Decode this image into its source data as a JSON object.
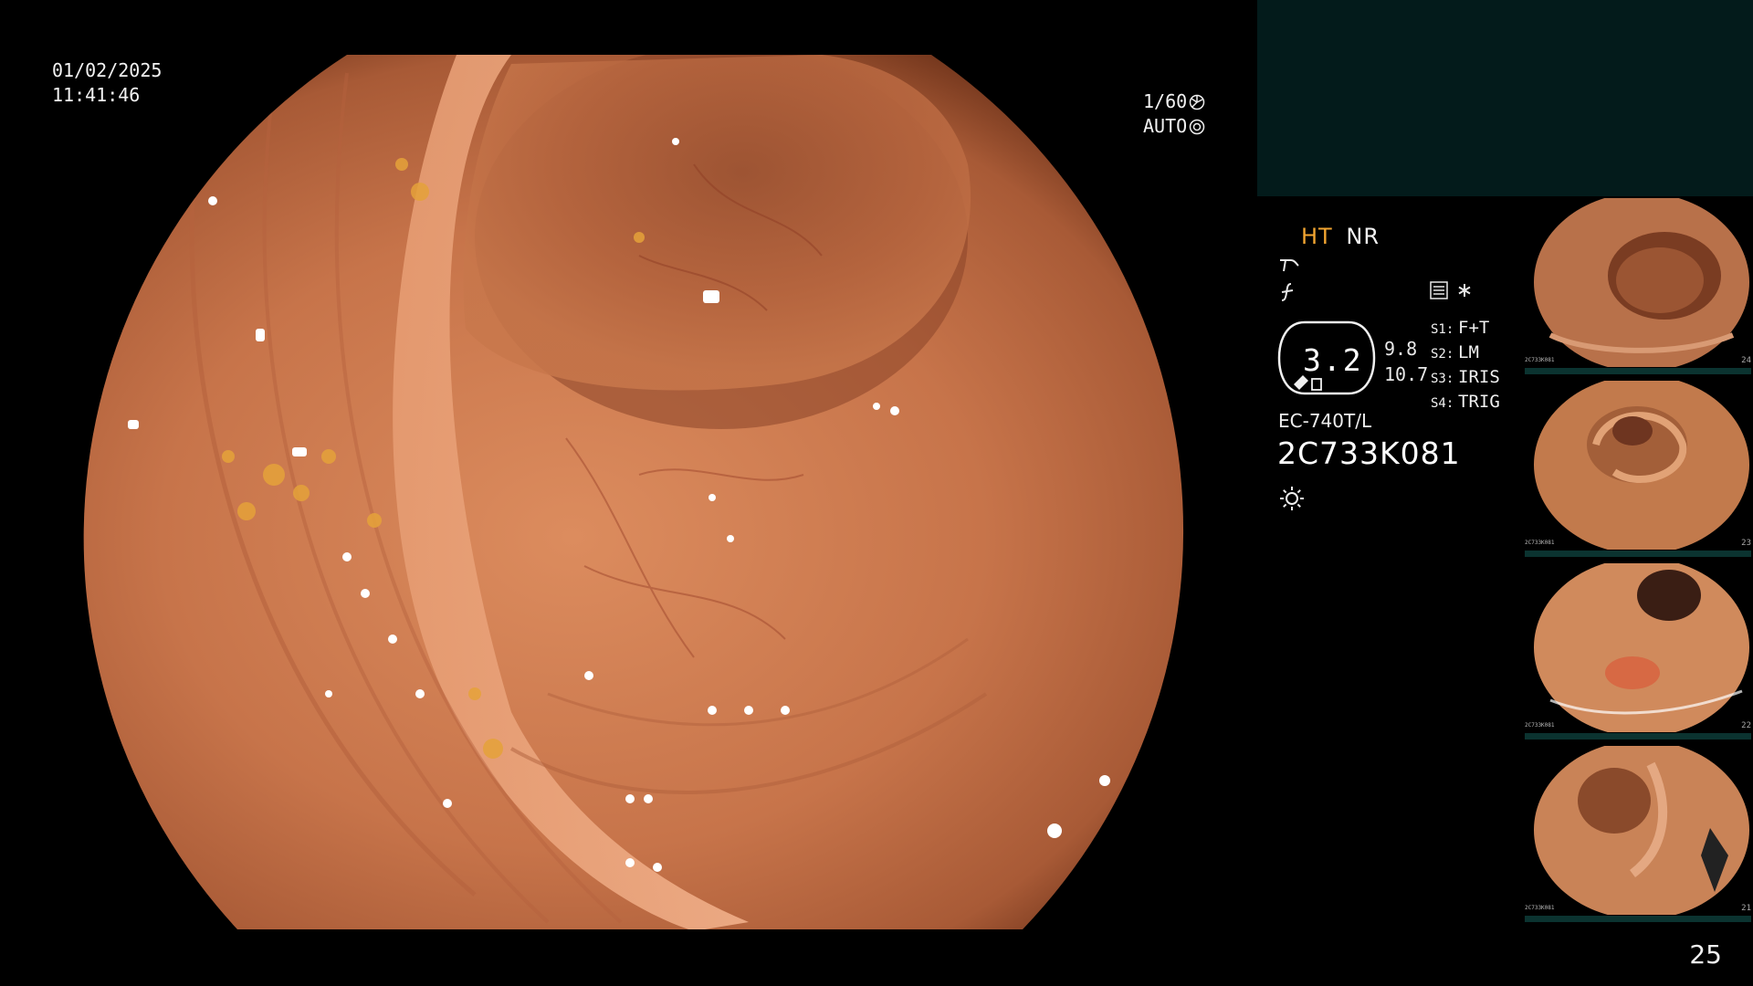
{
  "overlay": {
    "date": "01/02/2025",
    "time": "11:41:46",
    "shutter_speed": "1/60",
    "iris_mode": "AUTO"
  },
  "status": {
    "mode_ht": "HT",
    "mode_nr": "NR",
    "zoom": "3.2",
    "value_a": "9.8",
    "value_b": "10.7",
    "switches": [
      {
        "key": "S1:",
        "value": "F+T"
      },
      {
        "key": "S2:",
        "value": "LM"
      },
      {
        "key": "S3:",
        "value": "IRIS"
      },
      {
        "key": "S4:",
        "value": "TRIG"
      }
    ],
    "scope_model": "EC-740T/L",
    "scope_serial": "2C733K081",
    "icons": [
      "enhancement-icon",
      "structure-icon",
      "settings-icon",
      "asterisk-icon",
      "light-icon"
    ]
  },
  "thumbnails": [
    {
      "label": "Thumbnail 1",
      "index_text": "24",
      "meta": "2C733K081"
    },
    {
      "label": "Thumbnail 2",
      "index_text": "23",
      "meta": "2C733K081"
    },
    {
      "label": "Thumbnail 3",
      "index_text": "22",
      "meta": "2C733K081"
    },
    {
      "label": "Thumbnail 4",
      "index_text": "21",
      "meta": "2C733K081"
    }
  ],
  "page_number": "25",
  "colors": {
    "accent_orange": "#f2a531",
    "preview_panel": "#031b1b",
    "tissue": "#d9865a"
  }
}
